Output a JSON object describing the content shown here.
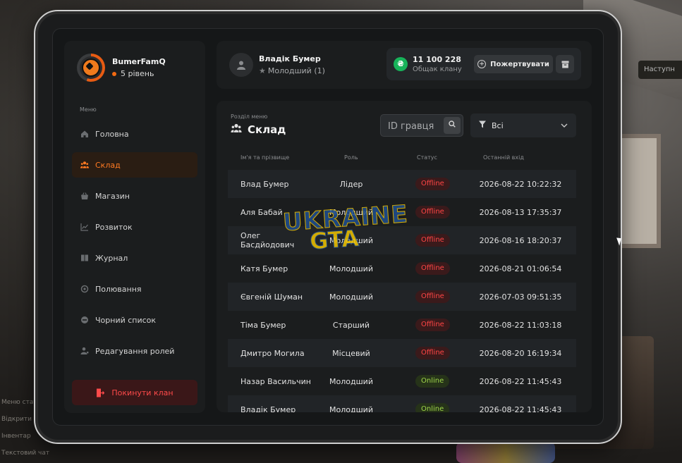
{
  "background": {
    "next_label": "Наступн",
    "chat_lines": [
      "Меню стат",
      "Відкрити",
      "Інвентар",
      "Текстовий чат"
    ]
  },
  "profile": {
    "name": "BumerFamQ",
    "level": "5 рівень"
  },
  "sidebar": {
    "caption": "Меню",
    "items": [
      {
        "label": "Головна",
        "icon": "home-icon"
      },
      {
        "label": "Склад",
        "icon": "users-icon",
        "active": true
      },
      {
        "label": "Магазин",
        "icon": "basket-icon"
      },
      {
        "label": "Розвиток",
        "icon": "chart-icon"
      },
      {
        "label": "Журнал",
        "icon": "book-icon"
      },
      {
        "label": "Полювання",
        "icon": "target-icon"
      },
      {
        "label": "Чорний список",
        "icon": "ban-icon"
      },
      {
        "label": "Редагування ролей",
        "icon": "user-edit-icon"
      }
    ],
    "leave_label": "Покинути клан"
  },
  "header": {
    "user_name": "Владік Бумер",
    "user_rank": "Молодший (1)",
    "bank_amount": "11 100 228",
    "bank_label": "Общак клану",
    "donate_label": "Пожертвувати",
    "coin_symbol": "₴"
  },
  "main": {
    "section_caption": "Розділ меню",
    "section_title": "Склад",
    "search_placeholder": "ID гравця",
    "filter_value": "Всі",
    "columns": {
      "name": "Ім'я та прізвище",
      "role": "Роль",
      "status": "Статус",
      "last": "Останній вхід"
    },
    "rows": [
      {
        "name": "Влад Бумер",
        "role": "Лідер",
        "status": "Offline",
        "last": "2026-08-22 10:22:32"
      },
      {
        "name": "Аля Бабай",
        "role": "Молодший",
        "status": "Offline",
        "last": "2026-08-13 17:35:37"
      },
      {
        "name": "Олег Басдйодович",
        "role": "Молодший",
        "status": "Offline",
        "last": "2026-08-16 18:20:37"
      },
      {
        "name": "Катя Бумер",
        "role": "Молодший",
        "status": "Offline",
        "last": "2026-08-21 01:06:54"
      },
      {
        "name": "Євгеній Шуман",
        "role": "Молодший",
        "status": "Offline",
        "last": "2026-07-03 09:51:35"
      },
      {
        "name": "Тіма Бумер",
        "role": "Старший",
        "status": "Offline",
        "last": "2026-08-22 11:03:18"
      },
      {
        "name": "Дмитро Могила",
        "role": "Місцевий",
        "status": "Offline",
        "last": "2026-08-20 16:19:34"
      },
      {
        "name": "Назар Васильчин",
        "role": "Молодший",
        "status": "Online",
        "last": "2026-08-22 11:45:43"
      },
      {
        "name": "Владік Бумер",
        "role": "Молодший",
        "status": "Online",
        "last": "2026-08-22 11:45:43"
      }
    ]
  },
  "watermark": {
    "line1": "UKRAINE",
    "line2": "GTA"
  },
  "colors": {
    "accent": "#ff7a22",
    "offline": "#ff4545",
    "online": "#9fd64a",
    "coin": "#17b35a"
  }
}
